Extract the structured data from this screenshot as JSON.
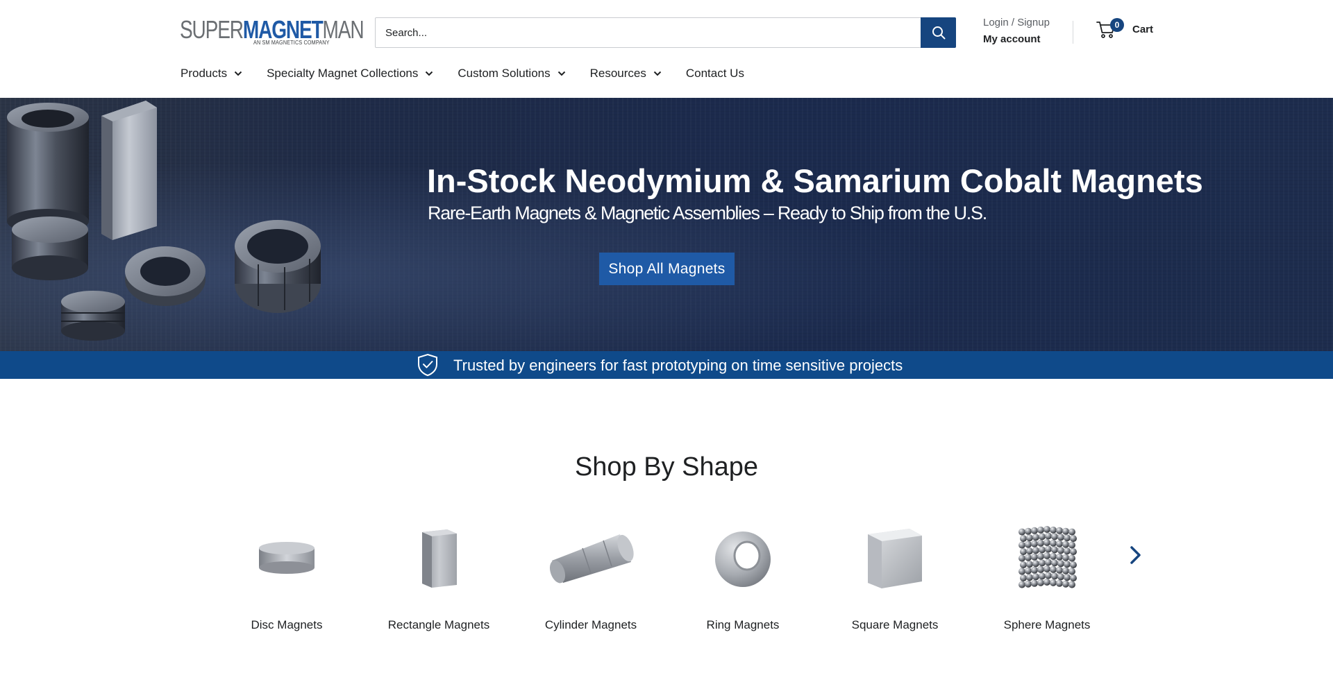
{
  "header": {
    "logo": {
      "part1": "SUPER",
      "part2": "MAGNET",
      "part3": "MAN",
      "tagline": "AN SM MAGNETICS COMPANY"
    },
    "search": {
      "placeholder": "Search...",
      "icon": "search-icon"
    },
    "account": {
      "login_label": "Login / Signup",
      "account_label": "My account"
    },
    "cart": {
      "count": "0",
      "label": "Cart",
      "icon": "cart-icon"
    }
  },
  "nav": {
    "items": [
      {
        "label": "Products",
        "has_dropdown": true
      },
      {
        "label": "Specialty Magnet Collections",
        "has_dropdown": true
      },
      {
        "label": "Custom Solutions",
        "has_dropdown": true
      },
      {
        "label": "Resources",
        "has_dropdown": true
      },
      {
        "label": "Contact Us",
        "has_dropdown": false
      }
    ]
  },
  "hero": {
    "title": "In-Stock Neodymium & Samarium Cobalt Magnets",
    "subtitle": "Rare-Earth Magnets & Magnetic Assemblies  – Ready to Ship from the U.S.",
    "cta_label": "Shop All Magnets"
  },
  "trust_bar": {
    "text": "Trusted by engineers for fast prototyping on time sensitive projects",
    "icon": "shield-check-icon"
  },
  "shop_by_shape": {
    "title": "Shop By Shape",
    "items": [
      {
        "label": "Disc Magnets",
        "icon": "disc-magnet-image"
      },
      {
        "label": "Rectangle Magnets",
        "icon": "rectangle-magnet-image"
      },
      {
        "label": "Cylinder Magnets",
        "icon": "cylinder-magnet-image"
      },
      {
        "label": "Ring Magnets",
        "icon": "ring-magnet-image"
      },
      {
        "label": "Square Magnets",
        "icon": "square-magnet-image"
      },
      {
        "label": "Sphere Magnets",
        "icon": "sphere-magnet-image"
      }
    ],
    "next_icon": "chevron-right-icon"
  },
  "colors": {
    "brand_blue": "#1f5aa6",
    "dark_blue": "#16457f",
    "trust_bar": "#0f4a8a",
    "hero_bg": "#1b2a4d"
  }
}
